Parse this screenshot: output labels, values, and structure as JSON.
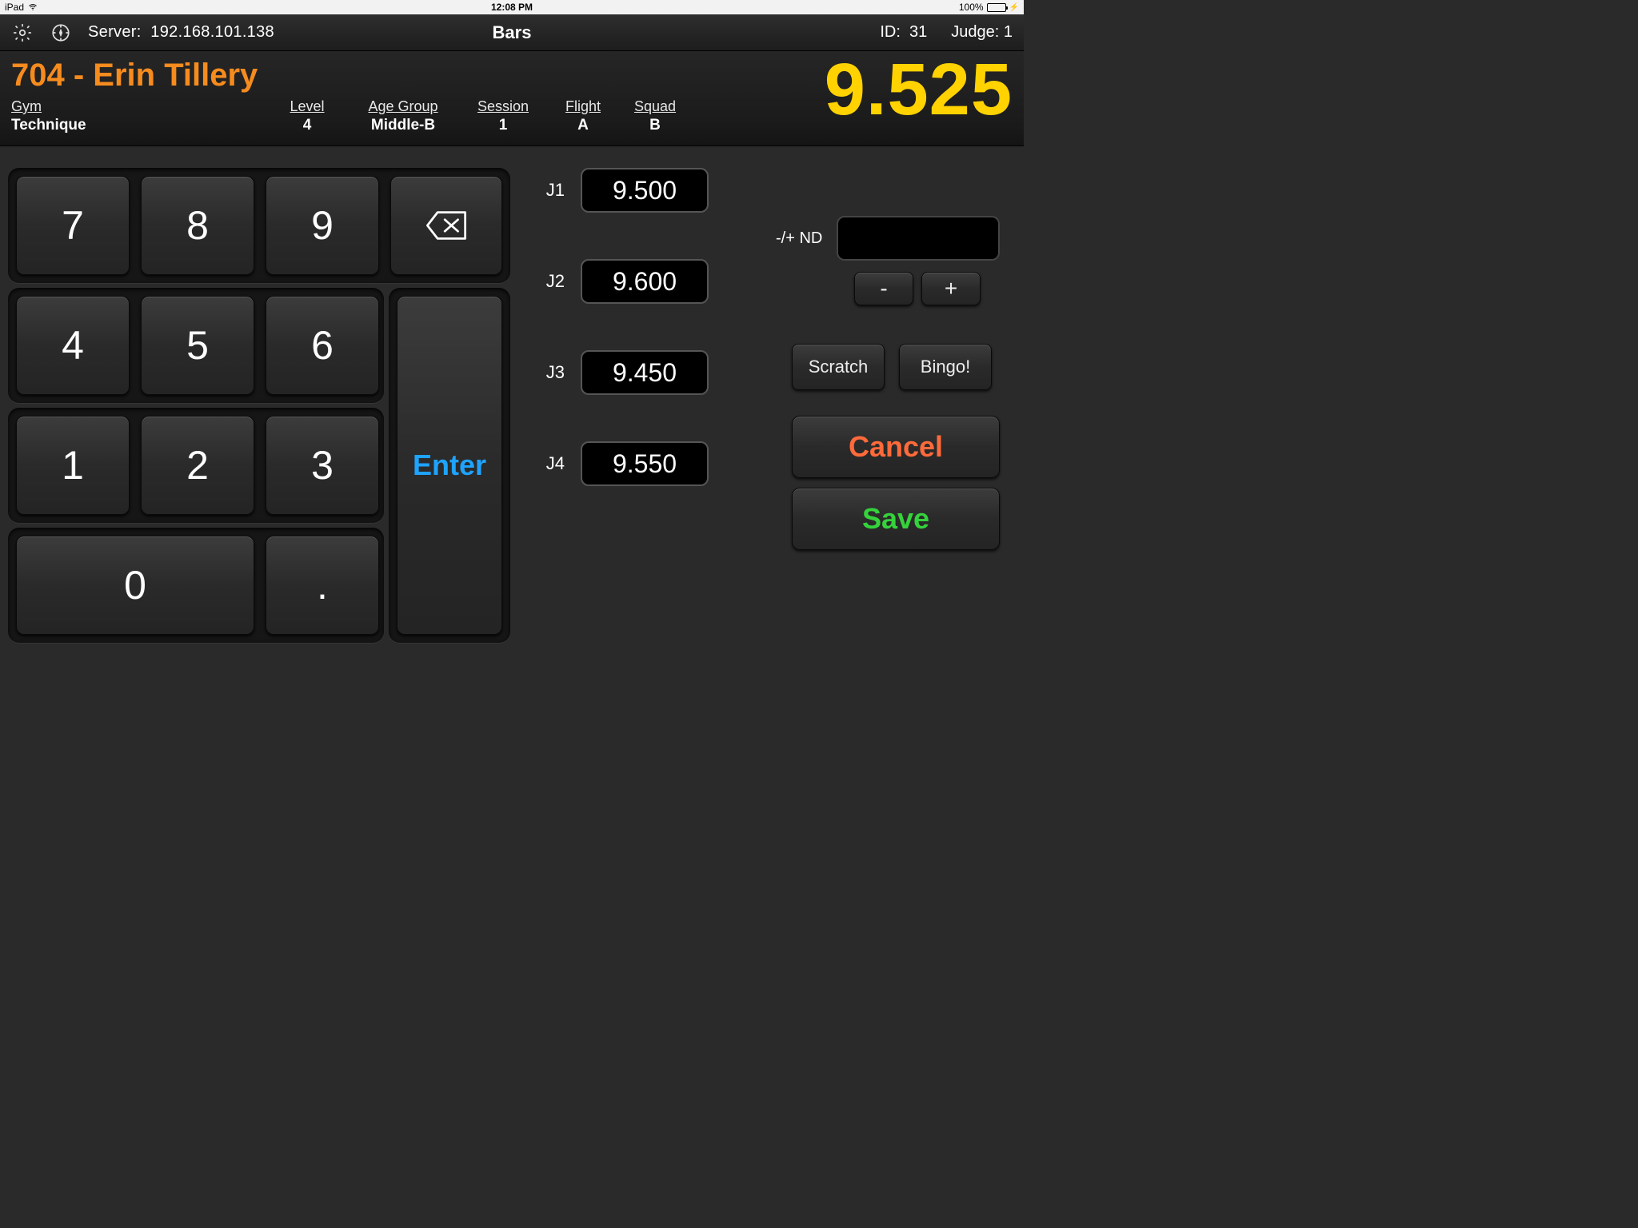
{
  "status": {
    "device": "iPad",
    "time": "12:08 PM",
    "battery": "100%"
  },
  "header": {
    "server_label": "Server:",
    "server_value": "192.168.101.138",
    "title": "Bars",
    "id_label": "ID:",
    "id_value": "31",
    "judge_label": "Judge:",
    "judge_value": "1"
  },
  "athlete": {
    "display": "704 - Erin Tillery",
    "score": "9.525",
    "meta": {
      "gym": {
        "label": "Gym",
        "value": "Technique"
      },
      "level": {
        "label": "Level",
        "value": "4"
      },
      "age_group": {
        "label": "Age Group",
        "value": "Middle-B"
      },
      "session": {
        "label": "Session",
        "value": "1"
      },
      "flight": {
        "label": "Flight",
        "value": "A"
      },
      "squad": {
        "label": "Squad",
        "value": "B"
      }
    }
  },
  "keypad": {
    "k7": "7",
    "k8": "8",
    "k9": "9",
    "k4": "4",
    "k5": "5",
    "k6": "6",
    "k1": "1",
    "k2": "2",
    "k3": "3",
    "k0": "0",
    "kdot": ".",
    "enter": "Enter"
  },
  "judges": [
    {
      "label": "J1",
      "value": "9.500"
    },
    {
      "label": "J2",
      "value": "9.600"
    },
    {
      "label": "J3",
      "value": "9.450"
    },
    {
      "label": "J4",
      "value": "9.550"
    }
  ],
  "nd": {
    "label": "-/+ ND",
    "value": "",
    "minus": "-",
    "plus": "+"
  },
  "actions": {
    "scratch": "Scratch",
    "bingo": "Bingo!",
    "cancel": "Cancel",
    "save": "Save"
  }
}
